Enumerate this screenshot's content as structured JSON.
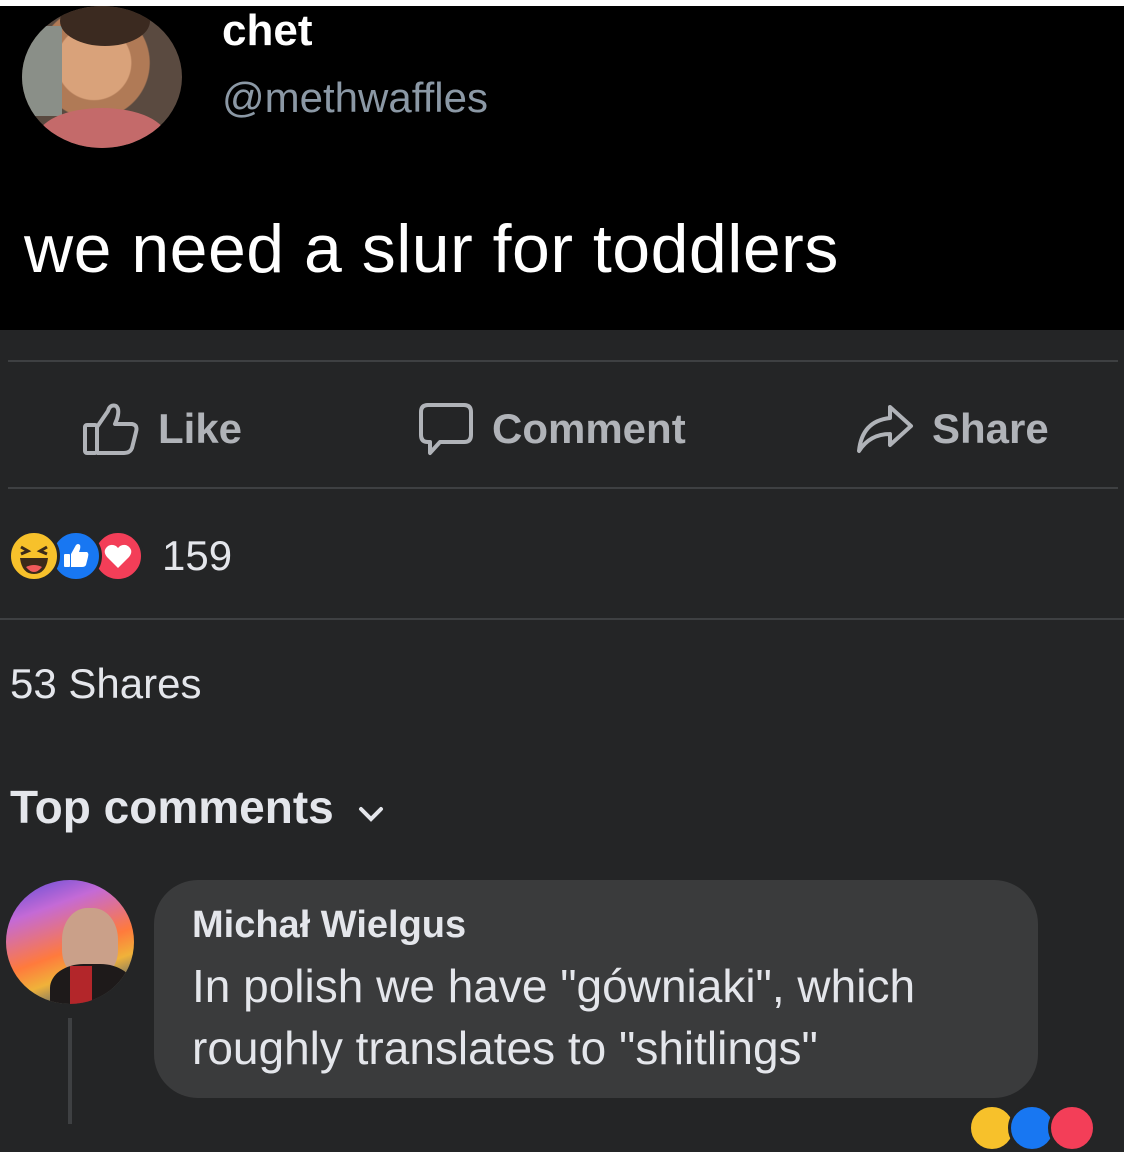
{
  "tweet": {
    "name": "chet",
    "handle": "@methwaffles",
    "text": "we need a slur for toddlers"
  },
  "actions": {
    "like_label": "Like",
    "comment_label": "Comment",
    "share_label": "Share"
  },
  "reactions": {
    "types": [
      "haha",
      "like",
      "love"
    ],
    "count": "159"
  },
  "shares_text": "53 Shares",
  "top_comments_label": "Top comments",
  "comment": {
    "author": "Michał Wielgus",
    "text_line1": "In polish we have \"gówniaki\", which",
    "text_line2": "roughly translates to \"shitlings\""
  },
  "colors": {
    "post_bg": "#242526",
    "tweet_bg": "#000000",
    "bubble_bg": "#3a3b3c",
    "like_blue": "#1877f2",
    "love_red": "#f33e58",
    "haha_yellow": "#f7c12b"
  }
}
